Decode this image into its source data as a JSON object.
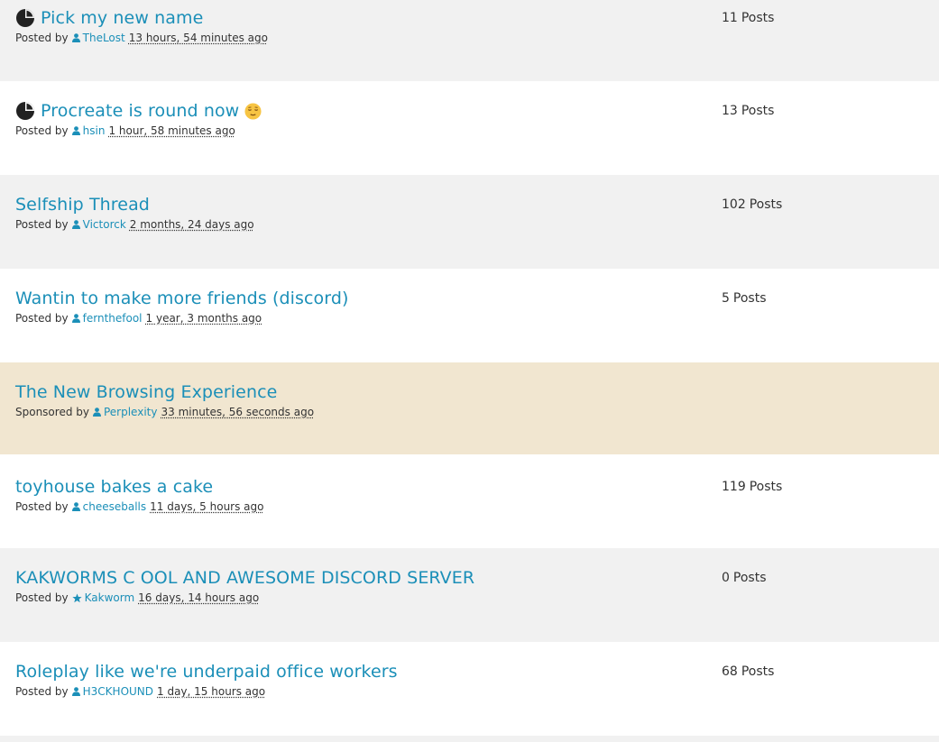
{
  "colors": {
    "accent": "#1b8fb8",
    "row_alt": "#f1f1f1",
    "row_white": "#ffffff",
    "row_sponsored": "#f1e6d0",
    "text": "#333333"
  },
  "threads": [
    {
      "title": "Pick my new name",
      "icon": "poll-icon",
      "meta_prefix": "Posted by",
      "user_icon": "user-icon",
      "user": "TheLost",
      "time": "13 hours, 54 minutes ago",
      "post_count": "11",
      "post_label": "Posts"
    },
    {
      "title": "Procreate is round now",
      "icon": "poll-icon",
      "emoji": "relieved-face-emoji",
      "meta_prefix": "Posted by",
      "user_icon": "user-icon",
      "user": "hsin",
      "time": "1 hour, 58 minutes ago",
      "post_count": "13",
      "post_label": "Posts"
    },
    {
      "title": "Selfship Thread",
      "meta_prefix": "Posted by",
      "user_icon": "user-icon",
      "user": "Victorck",
      "time": "2 months, 24 days ago",
      "post_count": "102",
      "post_label": "Posts"
    },
    {
      "title": "Wantin to make more friends (discord)",
      "meta_prefix": "Posted by",
      "user_icon": "user-icon",
      "user": "fernthefool",
      "time": "1 year, 3 months ago",
      "post_count": "5",
      "post_label": "Posts"
    },
    {
      "title": "The New Browsing Experience",
      "meta_prefix": "Sponsored by",
      "user_icon": "user-icon",
      "user": "Perplexity",
      "time": "33 minutes, 56 seconds ago",
      "sponsored": true
    },
    {
      "title": "toyhouse bakes a cake",
      "meta_prefix": "Posted by",
      "user_icon": "user-icon",
      "user": "cheeseballs",
      "time": "11 days, 5 hours ago",
      "post_count": "119",
      "post_label": "Posts"
    },
    {
      "title": "KAKWORMS C OOL AND AWESOME DISCORD SERVER",
      "meta_prefix": "Posted by",
      "user_icon": "star-icon",
      "user": "Kakworm",
      "time": "16 days, 14 hours ago",
      "post_count": "0",
      "post_label": "Posts"
    },
    {
      "title": "Roleplay like we're underpaid office workers",
      "meta_prefix": "Posted by",
      "user_icon": "user-icon",
      "user": "H3CKHOUND",
      "time": "1 day, 15 hours ago",
      "post_count": "68",
      "post_label": "Posts"
    }
  ]
}
